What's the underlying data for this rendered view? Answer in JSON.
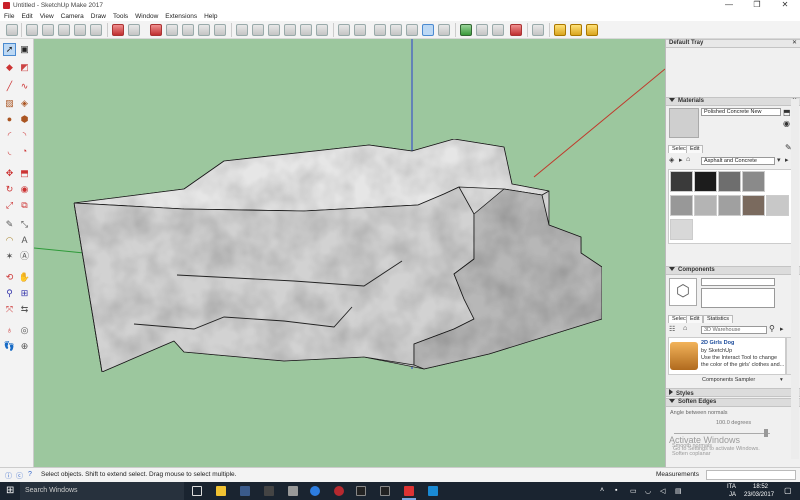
{
  "window": {
    "title": "Untitled - SketchUp Make 2017",
    "minimize": "—",
    "maximize": "❐",
    "close": "✕"
  },
  "menu": [
    "File",
    "Edit",
    "View",
    "Camera",
    "Draw",
    "Tools",
    "Window",
    "Extensions",
    "Help"
  ],
  "tray": {
    "title": "Default Tray",
    "close": "✕",
    "materials": {
      "header": "Materials",
      "name_value": "Polished Concrete New",
      "tabs": [
        "Select",
        "Edit"
      ],
      "library_value": "Asphalt and Concrete",
      "swatch_colors": [
        "#3a3a3a",
        "#1c1c1c",
        "#6e6e6e",
        "#8a8a8a",
        "#989898",
        "#b4b4b4",
        "#a0a0a0",
        "#7a6a5e",
        "#c8c8c8",
        "#d8d8d8"
      ]
    },
    "components": {
      "header": "Components",
      "tabs": [
        "Select",
        "Edit",
        "Statistics"
      ],
      "search_placeholder": "3D Warehouse",
      "result_title": "2D Girls Dog",
      "result_author": "by SketchUp",
      "result_desc": "Use the Interact Tool to change the color of the girls' clothes and...",
      "sampler_label": "Components Sampler"
    },
    "styles": {
      "header": "Styles"
    },
    "soften": {
      "header": "Soften Edges",
      "angle_label": "Angle between normals",
      "angle_value": "100.0  degrees",
      "smooth_normals": "Smooth normals",
      "soften_coplanar": "Soften coplanar"
    }
  },
  "status": {
    "hint": "Select objects. Shift to extend select. Drag mouse to select multiple.",
    "measurements_label": "Measurements"
  },
  "taskbar": {
    "search_placeholder": "Search Windows",
    "lang1": "ITA",
    "lang2": "JA",
    "time": "18:52",
    "date": "23/03/2017"
  },
  "watermark": {
    "line1": "Activate Windows",
    "line2": "Go to Settings to activate Windows."
  }
}
